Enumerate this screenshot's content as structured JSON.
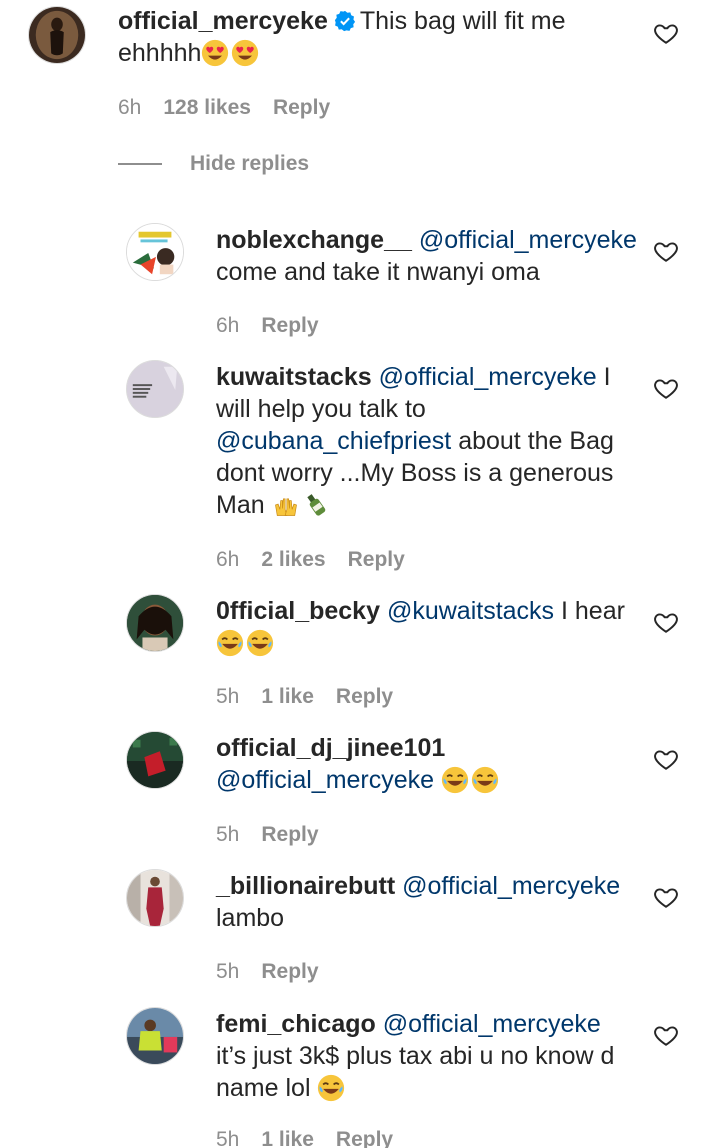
{
  "main_comment": {
    "username": "official_mercyeke",
    "text_line1": "This bag will fit me",
    "text_line2": "ehhhhh",
    "emoji": "heart-eyes-emoji",
    "time": "6h",
    "likes": "128 likes",
    "reply": "Reply"
  },
  "hide_replies": "Hide replies",
  "replies": [
    {
      "username": "noblexchange__",
      "mention": "@official_mercyeke",
      "text": "come and take it nwanyi oma",
      "time": "6h",
      "likes": "",
      "reply": "Reply"
    },
    {
      "username": "kuwaitstacks",
      "mention": "@official_mercyeke",
      "text_a": " I",
      "text_b": "will help you talk to",
      "mention2": "@cubana_chiefpriest",
      "text_c": " about the Bag",
      "text_d": "dont worry ...My Boss is a generous",
      "text_e": "Man",
      "time": "6h",
      "likes": "2 likes",
      "reply": "Reply"
    },
    {
      "username": "0fficial_becky",
      "mention": "@kuwaitstacks",
      "text": " I hear",
      "time": "5h",
      "likes": "1 like",
      "reply": "Reply"
    },
    {
      "username": "official_dj_jinee101",
      "mention": "@official_mercyeke",
      "time": "5h",
      "likes": "",
      "reply": "Reply"
    },
    {
      "username": "_billionairebutt",
      "mention": "@official_mercyeke",
      "text": "lambo",
      "time": "5h",
      "likes": "",
      "reply": "Reply"
    },
    {
      "username": "femi_chicago",
      "mention": "@official_mercyeke",
      "text_a": "it’s just 3k$ plus tax abi u no know d",
      "text_b": "name lol",
      "time": "5h",
      "likes": "1 like",
      "reply": "Reply"
    }
  ],
  "colors": {
    "text": "#262626",
    "secondary": "#8e8e8e",
    "mention": "#00376b",
    "verified": "#0095f6"
  }
}
